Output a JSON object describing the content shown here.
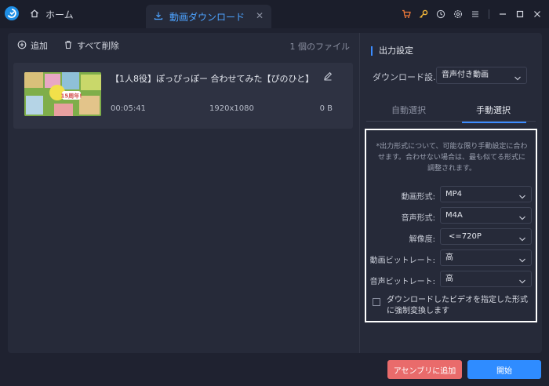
{
  "titlebar": {
    "home_tab": "ホーム",
    "download_tab": "動画ダウンロード",
    "icons": [
      "cart-icon",
      "key-icon",
      "history-icon",
      "settings-icon",
      "menu-icon",
      "minimize-icon",
      "maximize-icon",
      "close-icon"
    ]
  },
  "toolbar": {
    "add_label": "追加",
    "delete_all_label": "すべて削除",
    "file_count": "1 個のファイル"
  },
  "file": {
    "title": "【1人8役】ぽっぴっぽー 合わせてみた【ぴのひと】",
    "duration": "00:05:41",
    "resolution": "1920x1080",
    "size": "0 B",
    "thumb_text": "15周年!"
  },
  "output": {
    "title": "出力設定",
    "download_label": "ダウンロード設...",
    "download_value": "音声付き動画",
    "tab_auto": "自動選択",
    "tab_manual": "手動選択",
    "note": "*出力形式について、可能な限り手動設定に合わせます。合わせない場合は、最も似てる形式に調整されます。",
    "options": [
      {
        "label": "動画形式:",
        "value": "MP4"
      },
      {
        "label": "音声形式:",
        "value": "M4A"
      },
      {
        "label": "解像度:",
        "value": "<=720P"
      },
      {
        "label": "動画ビットレート:",
        "value": "高"
      },
      {
        "label": "音声ビットレート:",
        "value": "高"
      }
    ],
    "force_convert": "ダウンロードしたビデオを指定した形式に強制変換します",
    "force_checked": false
  },
  "actions": {
    "assembly": "アセンブリに追加",
    "start": "開始"
  },
  "colors": {
    "accent": "#2f8cff",
    "danger": "#e96b6b",
    "background": "#1f2230",
    "panel": "#262a39"
  }
}
